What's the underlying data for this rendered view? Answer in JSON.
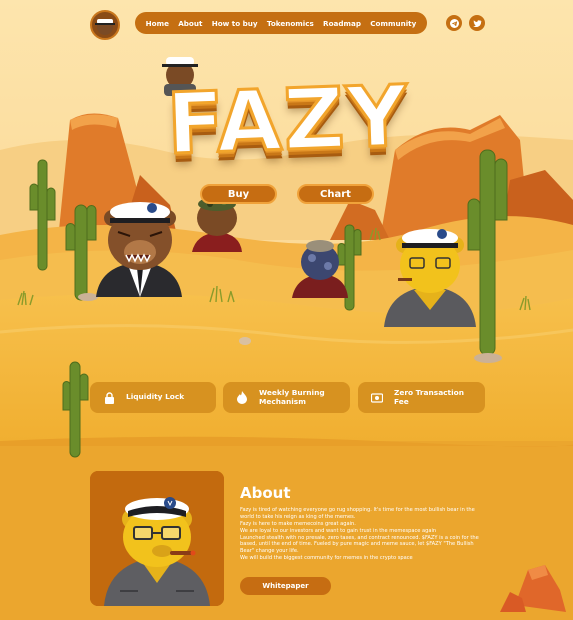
{
  "nav": {
    "links": [
      "Home",
      "About",
      "How to buy",
      "Tokenomics",
      "Roadmap",
      "Community"
    ],
    "socials": [
      "telegram-icon",
      "twitter-icon"
    ]
  },
  "hero": {
    "title": "FAZY",
    "buttons": [
      "Buy",
      "Chart"
    ]
  },
  "features": [
    {
      "label": "Liquidity Lock",
      "icon": "lock-icon"
    },
    {
      "label": "Weekly Burning Mechanism",
      "icon": "flame-icon"
    },
    {
      "label": "Zero Transaction Fee",
      "icon": "cash-icon"
    }
  ],
  "about": {
    "title": "About",
    "paragraphs": [
      "Fazy is tired of watching everyone go rug shopping. It's time for the most bullish bear in the world to take his reign as king of the memes.",
      "Fazy is here to make memecoins great again.",
      "We are loyal to our investors and want to gain trust in the memespace again",
      "Launched stealth with no presale, zero taxes, and contract renounced. $FAZY is a coin for the based, until the end of time. Fueled by pure magic and meme sauce, let $FAZY \"The Bullish Bear\" change your life.",
      "We will build the biggest community for memes in the crypto space"
    ],
    "button": "Whitepaper"
  },
  "colors": {
    "accent": "#c56f12",
    "sand": "#f3b53a",
    "sky": "#fde2a8",
    "feature_bg": "#d79220"
  }
}
